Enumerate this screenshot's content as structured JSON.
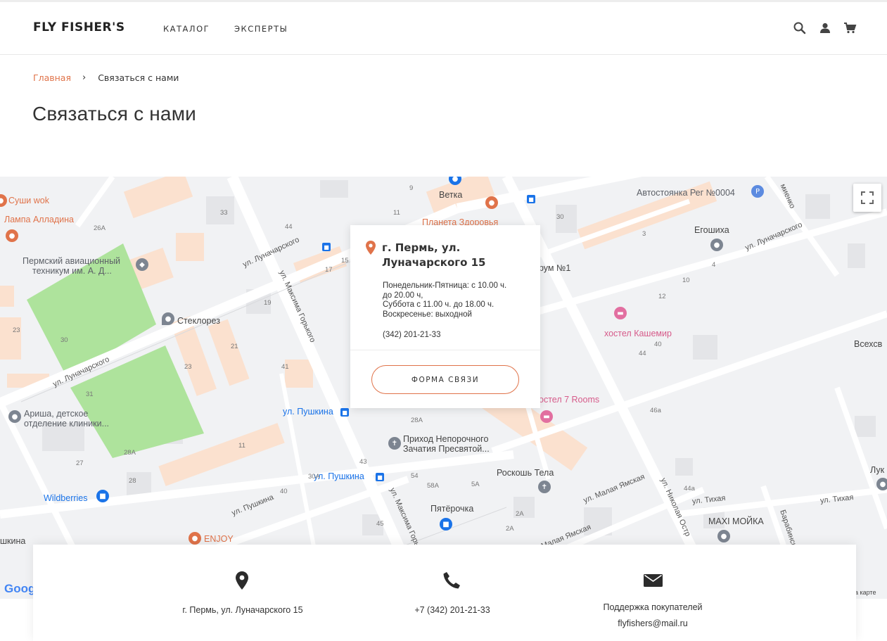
{
  "header": {
    "logo": "FLY FISHER'S",
    "nav": [
      "КАТАЛОГ",
      "ЭКСПЕРТЫ"
    ],
    "icons": [
      "search-icon",
      "user-icon",
      "cart-icon"
    ]
  },
  "breadcrumb": {
    "home": "Главная",
    "separator": "›",
    "current": "Связаться с нами"
  },
  "page_title": "Связаться с нами",
  "map": {
    "labels": {
      "sushi": "Суши wok",
      "lampa": "Лампа Алладина",
      "aviation_1": "Пермский авиационный",
      "aviation_2": "техникум им. А. Д...",
      "steklorez": "Стеклорез",
      "arisha_1": "Ариша, детское",
      "arisha_2": "отделение клиники...",
      "wildberries": "Wildberries",
      "enjoy": "ENJOY",
      "pushkina_left": "шкина",
      "vetka": "Ветка",
      "planeta": "Планета Здоровья",
      "avtostoyanka": "Автостоянка Рег №0004",
      "egoshikha": "Егошиха",
      "forum": "рум №1",
      "hostel_kashemir": "хостел Кашемир",
      "hostel_7rooms": "остел 7 Rooms",
      "vsekhsv": "Всехсв",
      "prihod_1": "Приход Непорочного",
      "prihod_2": "Зачатия Пресвятой...",
      "roskosh": "Роскошь Тела",
      "pyaterochka": "Пятёрочка",
      "maxi": "MAXI МОЙКА",
      "luk": "Лук",
      "pushkina_stop_1": "ул. Пушкина",
      "pushkina_stop_2": "ул. Пушкина"
    },
    "streets": {
      "lunacharskogo_1": "ул. Луначарского",
      "lunacharskogo_2": "ул. Луначарского",
      "maksima_gorkogo_1": "ул. Максима Горького",
      "maksima_gorkogo_2": "ул. Максима Горьк...",
      "lunacharskogo_3": "ул. Луначарского",
      "pushkina": "ул. Пушкина",
      "malaya_yamskaya_1": "ул. Малая Ямская",
      "malaya_yamskaya_2": "Малая Ямская",
      "tikhaya_1": "ул. Тихая",
      "tikhaya_2": "ул. Тихая",
      "nikolaya_ostr": "ул. Николая Остр",
      "barabinskaya": "Барабинска",
      "mienko": "миенко"
    },
    "numbers": [
      "33",
      "26A",
      "44",
      "11",
      "17",
      "15",
      "19",
      "21",
      "23",
      "41",
      "30",
      "23",
      "31",
      "27",
      "28",
      "28A",
      "11",
      "30A",
      "43",
      "40",
      "54",
      "58A",
      "5A",
      "45",
      "2A",
      "2A",
      "30",
      "3",
      "4",
      "10",
      "12",
      "40",
      "44",
      "46a",
      "44a",
      "28A",
      "9"
    ],
    "google": "Google",
    "map_data": "на карте"
  },
  "popup": {
    "address": "г. Пермь, ул. Луначарского 15",
    "hours": [
      "Понедельник-Пятница: с 10.00 ч.",
      "до 20.00 ч,",
      "Суббота с 11.00 ч. до 18.00 ч.",
      "Воскресенье: выходной"
    ],
    "phone": "(342) 201-21-33",
    "button": "ФОРМА СВЯЗИ"
  },
  "contacts": {
    "address": "г. Пермь, ул. Луначарского 15",
    "phone": "+7 (342) 201-21-33",
    "support_title": "Поддержка покупателей",
    "email": "flyfishers@mail.ru"
  },
  "colors": {
    "accent": "#e0734a",
    "map_bg": "#f1f2f4",
    "park": "#aee39c",
    "building": "#fbe1cf"
  }
}
